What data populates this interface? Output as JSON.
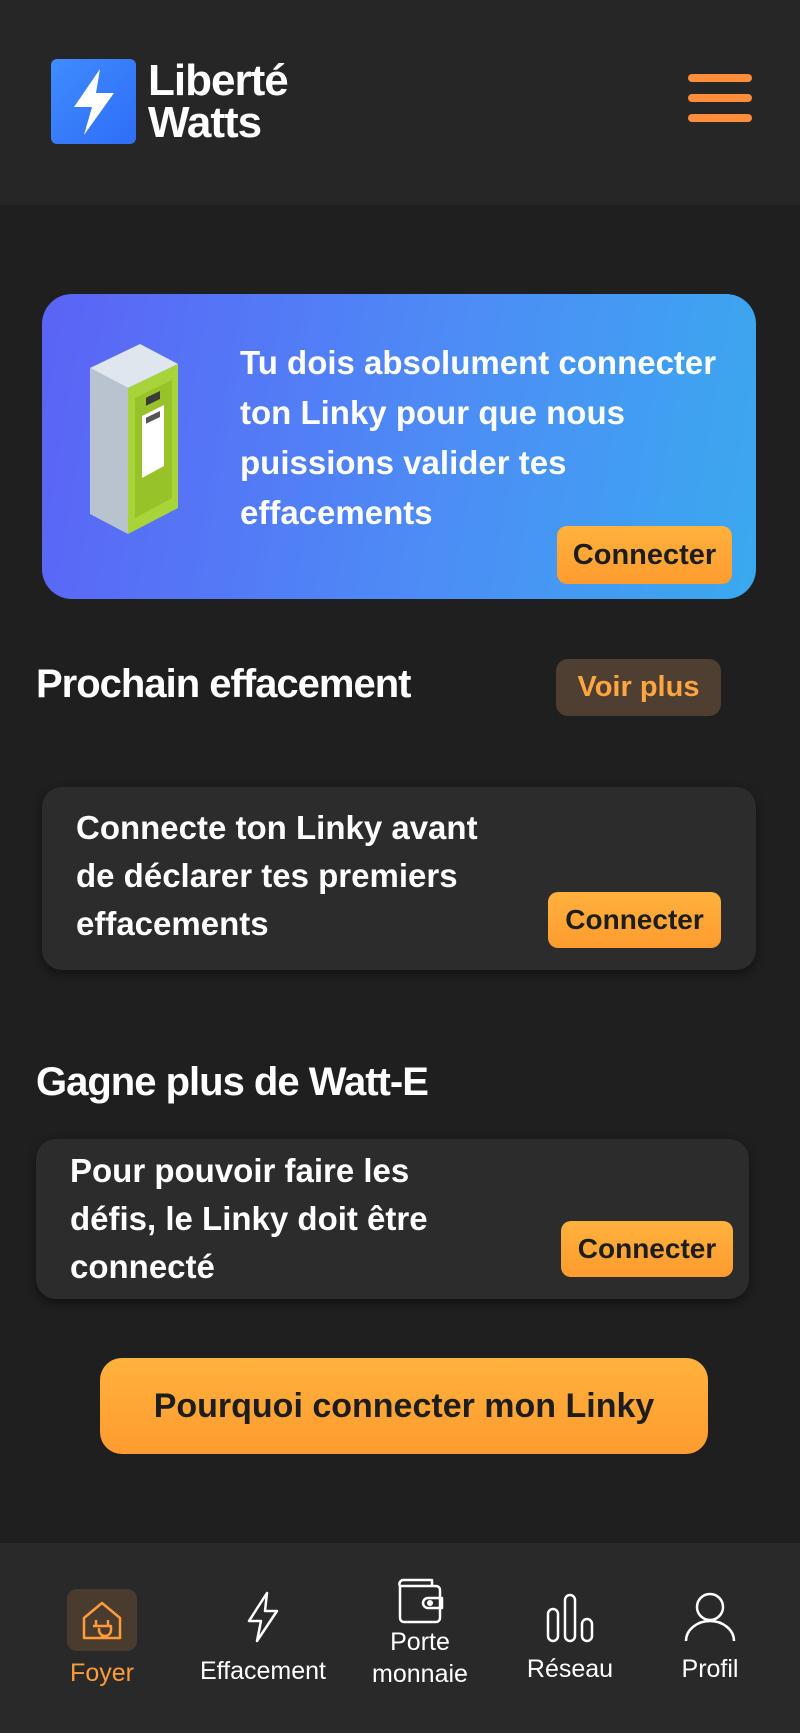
{
  "header": {
    "brand_line1": "Liberté",
    "brand_line2": "Watts"
  },
  "banner": {
    "message": "Tu dois absolument connecter ton Linky pour que nous puissions valider tes effacements",
    "button": "Connecter"
  },
  "next_erasure": {
    "title": "Prochain effacement",
    "see_more": "Voir plus",
    "card_text": "Connecte ton Linky avant de déclarer tes premiers effacements",
    "card_button": "Connecter"
  },
  "earn_more": {
    "title": "Gagne plus de Watt-E",
    "card_text": "Pour pouvoir faire les défis, le Linky doit être connecté",
    "card_button": "Connecter"
  },
  "why_button": "Pourquoi connecter mon Linky",
  "bottom_nav": {
    "items": [
      {
        "label": "Foyer",
        "icon": "house-plug-icon",
        "active": true
      },
      {
        "label": "Effacement",
        "icon": "lightning-icon",
        "active": false
      },
      {
        "label_line1": "Porte",
        "label_line2": "monnaie",
        "icon": "wallet-icon",
        "active": false
      },
      {
        "label": "Réseau",
        "icon": "bar-chart-icon",
        "active": false
      },
      {
        "label": "Profil",
        "icon": "user-icon",
        "active": false
      }
    ]
  },
  "colors": {
    "accent_orange": "#ff9b2f",
    "banner_gradient_start": "#5b63f6",
    "banner_gradient_end": "#3aa9ef",
    "background": "#1f1f1f",
    "card": "#2c2c2c"
  }
}
